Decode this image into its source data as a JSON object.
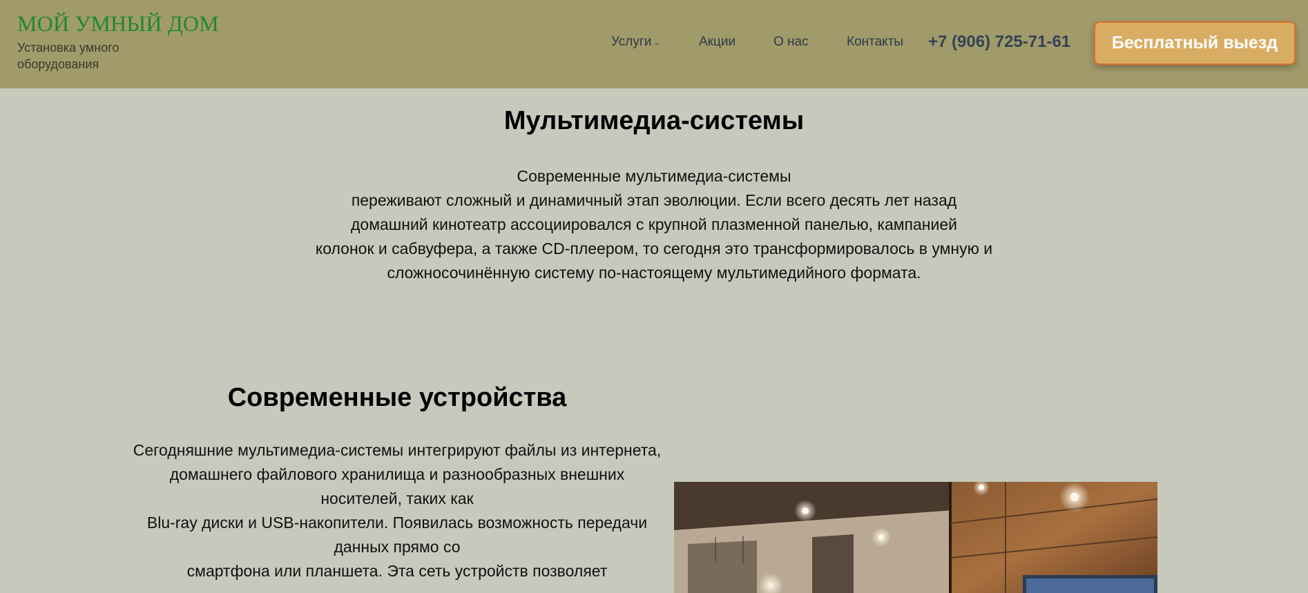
{
  "header": {
    "logo_title": "МОЙ УМНЫЙ ДОМ",
    "logo_subtitle": "Установка умного оборудования",
    "nav": {
      "uslugi": "Услуги",
      "akcii": "Акции",
      "o_nas": "О нас",
      "kontakty": "Контакты"
    },
    "phone": "+7 (906) 725-71-61",
    "cta": "Бесплатный выезд"
  },
  "section1": {
    "title": "Мультимедиа-системы",
    "lines": [
      "Современные мультимедиа-системы",
      "переживают сложный и динамичный этап эволюции. Если всего десять лет назад",
      "домашний кинотеатр ассоциировался с крупной плазменной панелью, кампанией",
      "колонок и сабвуфера, а также CD-плеером, то сегодня это трансформировалось в умную и",
      "сложносочинённую систему по-настоящему мультимедийного формата."
    ]
  },
  "section2": {
    "title": "Современные устройства",
    "lines": [
      "Сегодняшние мультимедиа-системы интегрируют файлы из интернета,",
      "домашнего файлового хранилища и разнообразных внешних носителей, таких как",
      "Blu-ray диски и USB-накопители. Появилась возможность передачи данных прямо со",
      "смартфона или планшета. Эта сеть устройств позволяет"
    ]
  },
  "colors": {
    "header_bg": "#a19a6b",
    "page_bg": "#c6c9bc",
    "logo": "#1f8a2a",
    "cta_bg": "#d9ac63",
    "cta_border": "#d9702a",
    "nav_text": "#2e3a46"
  },
  "icons": {
    "dropdown": "chevron-down-icon"
  }
}
